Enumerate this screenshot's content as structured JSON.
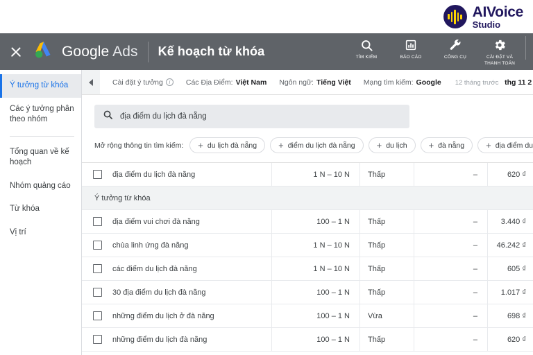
{
  "brand": {
    "name_primary": "AIVoice",
    "name_secondary": "Studio",
    "mark_icon": "audio-waveform-icon",
    "color": "#21175e",
    "bar_color": "#ffd400"
  },
  "header": {
    "close_icon": "close-icon",
    "product_logo_icon": "google-ads-logo-icon",
    "product_name_bold": "Google",
    "product_name_light": " Ads",
    "page_title": "Kế hoạch từ khóa",
    "bar_color": "#5f6368",
    "actions": [
      {
        "icon": "search-icon",
        "label": "TÌM KIẾM"
      },
      {
        "icon": "report-chart-icon",
        "label": "BÁO CÁO"
      },
      {
        "icon": "wrench-icon",
        "label": "CÔNG CỤ"
      },
      {
        "icon": "gear-icon",
        "label": "CÀI ĐẶT VÀ THANH TOÁN"
      }
    ]
  },
  "sidebar": {
    "items": [
      {
        "label": "Ý tưởng từ khóa",
        "active": true
      },
      {
        "label": "Các ý tưởng phân theo nhóm",
        "active": false
      },
      {
        "label": "Tổng quan về kế hoạch",
        "active": false
      },
      {
        "label": "Nhóm quảng cáo",
        "active": false
      },
      {
        "label": "Từ khóa",
        "active": false
      },
      {
        "label": "Vị trí",
        "active": false
      }
    ],
    "active_color": "#1a73e8"
  },
  "filter_bar": {
    "collapse_icon": "chevron-left-icon",
    "settings_label": "Cài đặt ý tưởng",
    "info_icon": "info-icon",
    "locations_key": "Các Địa Điểm:",
    "locations_value": "Việt Nam",
    "language_key": "Ngôn ngữ:",
    "language_value": "Tiếng Việt",
    "network_key": "Mạng tìm kiếm:",
    "network_value": "Google",
    "date_relative": "12 tháng trước",
    "date_value": "thg 11 2"
  },
  "search": {
    "icon": "search-icon",
    "value": "địa điểm du lịch đà nẵng",
    "placeholder": "địa điểm du lịch đà nẵng"
  },
  "expansions": {
    "label": "Mở rộng thông tin tìm kiếm:",
    "chips": [
      "du lịch đà nẵng",
      "điểm du lịch đà nẵng",
      "du lịch",
      "đà nẵng",
      "địa điểm du lịc"
    ]
  },
  "table": {
    "group_label": "Ý tưởng từ khóa",
    "primary_row": {
      "keyword": "địa điểm du lịch đà nẵng",
      "volume": "1 N – 10 N",
      "competition": "Thấp",
      "bid_low": "–",
      "bid_high": "620 ₫"
    },
    "rows": [
      {
        "keyword": "địa điểm vui chơi đà nẵng",
        "volume": "100 – 1 N",
        "competition": "Thấp",
        "bid_low": "–",
        "bid_high": "3.440 ₫"
      },
      {
        "keyword": "chùa linh ứng đà nẵng",
        "volume": "1 N – 10 N",
        "competition": "Thấp",
        "bid_low": "–",
        "bid_high": "46.242 ₫"
      },
      {
        "keyword": "các điểm du lịch đà nẵng",
        "volume": "1 N – 10 N",
        "competition": "Thấp",
        "bid_low": "–",
        "bid_high": "605 ₫"
      },
      {
        "keyword": "30 địa điểm du lịch đà nẵng",
        "volume": "100 – 1 N",
        "competition": "Thấp",
        "bid_low": "–",
        "bid_high": "1.017 ₫"
      },
      {
        "keyword": "những điểm du lịch ở đà nẵng",
        "volume": "100 – 1 N",
        "competition": "Vừa",
        "bid_low": "–",
        "bid_high": "698 ₫"
      },
      {
        "keyword": "những điểm du lịch đà nẵng",
        "volume": "100 – 1 N",
        "competition": "Thấp",
        "bid_low": "–",
        "bid_high": "620 ₫"
      }
    ]
  }
}
